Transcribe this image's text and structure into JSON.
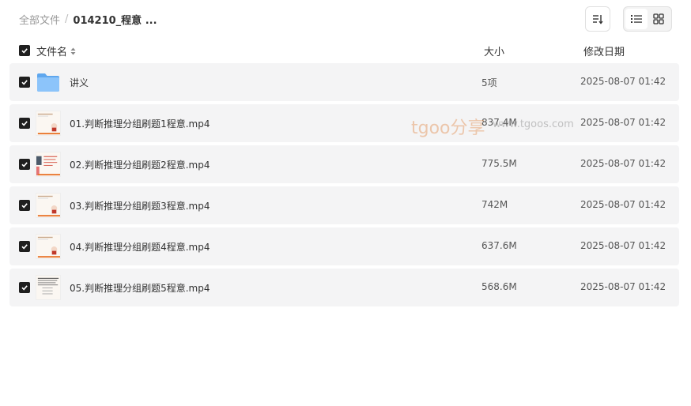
{
  "breadcrumb": {
    "root": "全部文件",
    "separator": "/",
    "current": "014210_程意 ..."
  },
  "columns": {
    "name": "文件名",
    "size": "大小",
    "date": "修改日期"
  },
  "files": [
    {
      "name": "讲义",
      "size": "5项",
      "date": "2025-08-07 01:42",
      "type": "folder-icon"
    },
    {
      "name": "01.判断推理分组刷题1程意.mp4",
      "size": "837.4M",
      "date": "2025-08-07 01:42",
      "type": "video-thumbnail"
    },
    {
      "name": "02.判断推理分组刷题2程意.mp4",
      "size": "775.5M",
      "date": "2025-08-07 01:42",
      "type": "video-thumbnail"
    },
    {
      "name": "03.判断推理分组刷题3程意.mp4",
      "size": "742M",
      "date": "2025-08-07 01:42",
      "type": "video-thumbnail"
    },
    {
      "name": "04.判断推理分组刷题4程意.mp4",
      "size": "637.6M",
      "date": "2025-08-07 01:42",
      "type": "video-thumbnail"
    },
    {
      "name": "05.判断推理分组刷题5程意.mp4",
      "size": "568.6M",
      "date": "2025-08-07 01:42",
      "type": "video-thumbnail"
    }
  ],
  "watermark": {
    "brand": "tgoo分享",
    "url": "www.tgoos.com"
  },
  "colors": {
    "checkbox": "#1f1f1f",
    "row_bg": "#f4f4f5",
    "folder": "#7ab8f5",
    "accent_bar": "#e8742a"
  }
}
